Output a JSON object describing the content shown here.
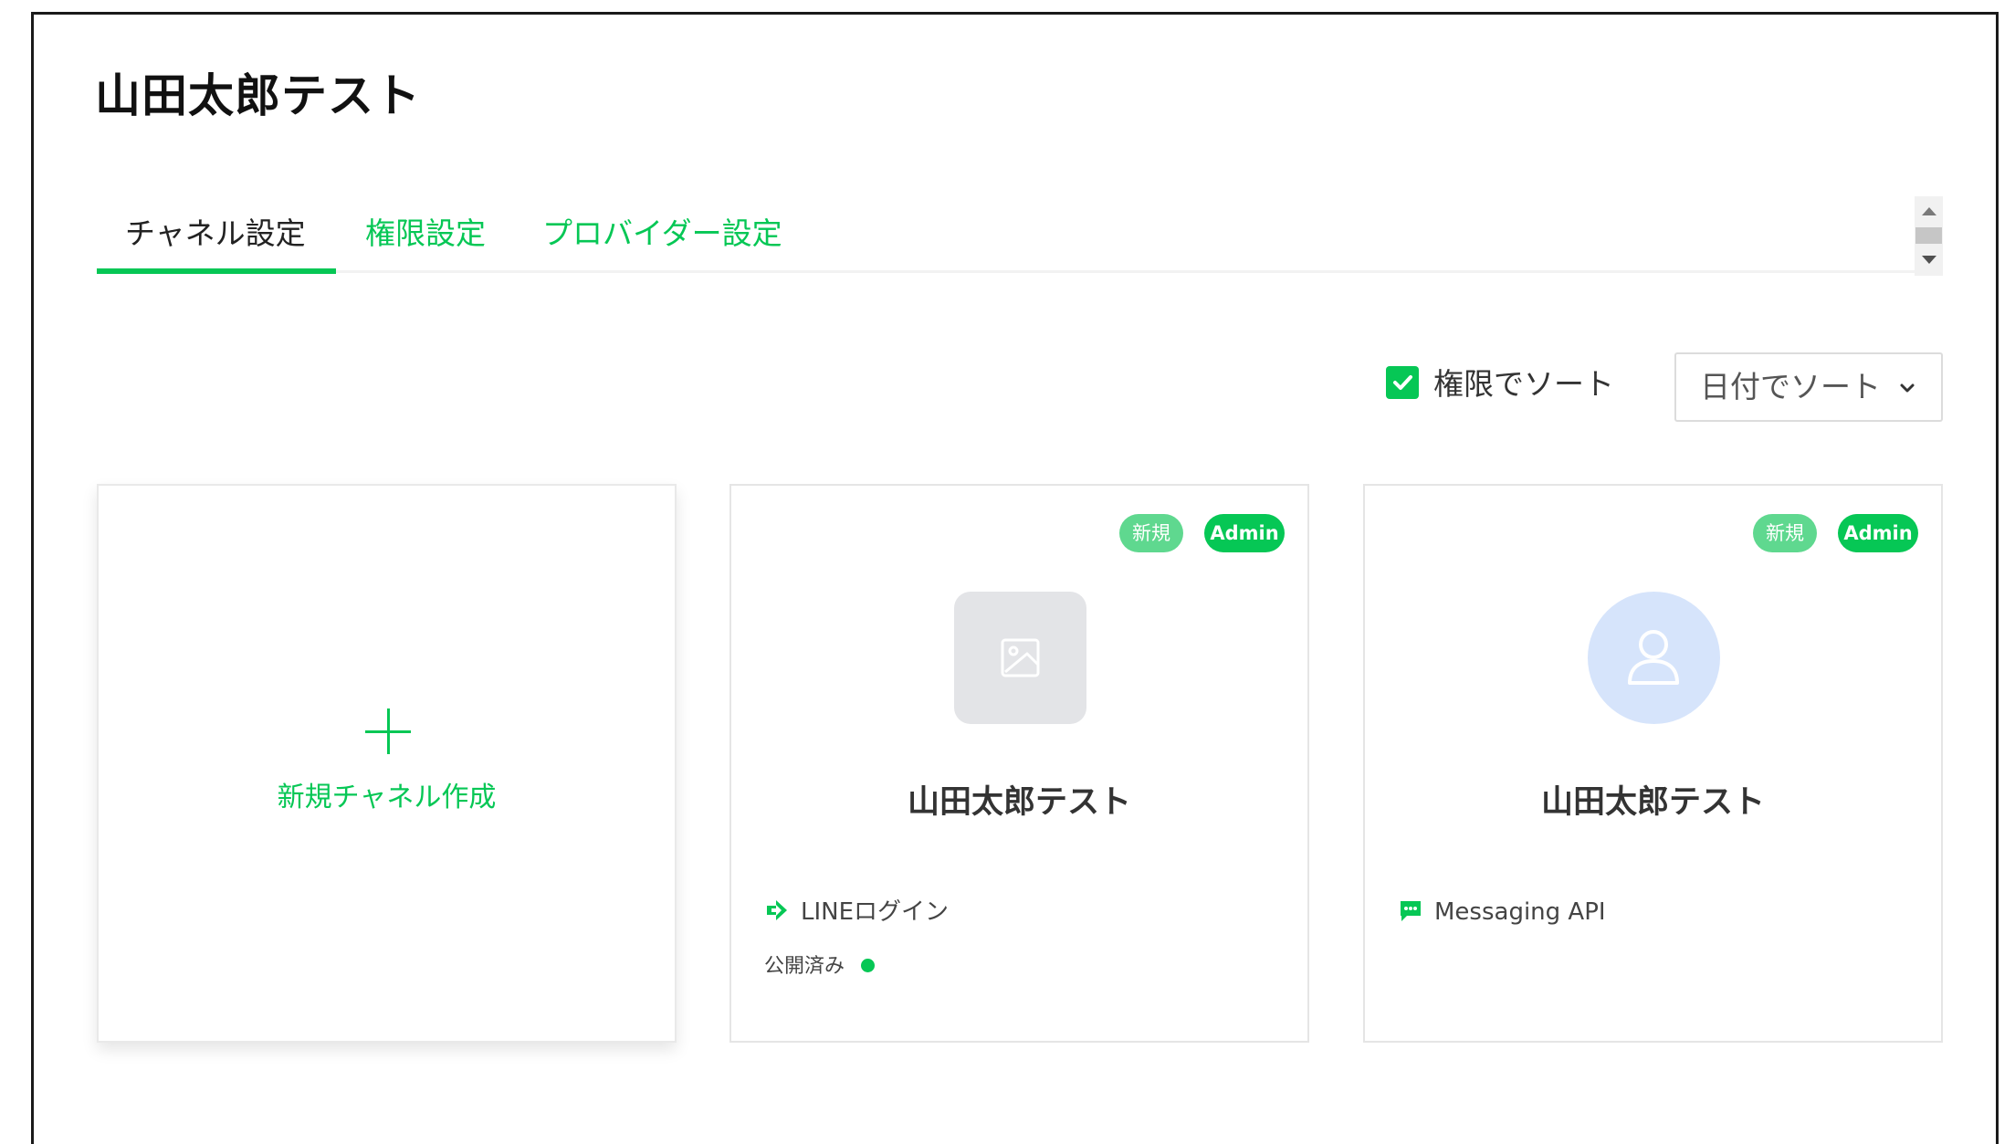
{
  "header": {
    "title": "山田太郎テスト"
  },
  "tabs": [
    {
      "label": "チャネル設定",
      "active": true
    },
    {
      "label": "権限設定",
      "active": false
    },
    {
      "label": "プロバイダー設定",
      "active": false
    }
  ],
  "sort": {
    "checkbox_label": "権限でソート",
    "checked": true,
    "select_value": "日付でソート"
  },
  "create_card": {
    "label": "新規チャネル作成"
  },
  "channels": [
    {
      "badges": [
        "新規",
        "Admin"
      ],
      "icon": "image-placeholder-icon",
      "name": "山田太郎テスト",
      "type": "LINEログイン",
      "type_icon": "line-login-icon",
      "status": "公開済み"
    },
    {
      "badges": [
        "新規",
        "Admin"
      ],
      "icon": "user-placeholder-icon",
      "name": "山田太郎テスト",
      "type": "Messaging API",
      "type_icon": "messaging-api-icon"
    }
  ],
  "colors": {
    "accent": "#06c755",
    "badge_new": "#5fd88f",
    "avatar_bg": "#d6e4fb",
    "image_bg": "#e3e4e7"
  }
}
